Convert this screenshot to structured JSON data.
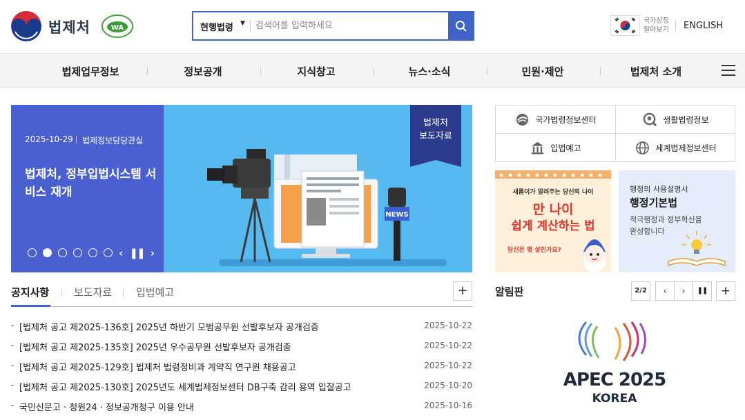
{
  "header": {
    "site_name": "법제처",
    "search": {
      "scope": "현행법령",
      "placeholder": "검색어를 입력하세요"
    },
    "national_symbols": "국가상징\n알아보기",
    "language": "ENGLISH"
  },
  "nav": {
    "items": [
      {
        "label": "법제업무정보"
      },
      {
        "label": "정보공개"
      },
      {
        "label": "지식창고"
      },
      {
        "label": "뉴스·소식"
      },
      {
        "label": "민원·제안"
      },
      {
        "label": "법제처 소개"
      }
    ]
  },
  "banner": {
    "date": "2025-10-29",
    "department": "법제정보담당관실",
    "title": "법제처, 정부입법시스템 서비스 재개",
    "badge": "법제처\n보도자료",
    "slide_count": 6,
    "active_slide": 2,
    "news_label": "NEWS"
  },
  "quick_links": [
    {
      "label": "국가법령정보센터",
      "icon": "globe-swirl-icon"
    },
    {
      "label": "생활법령정보",
      "icon": "search-person-icon"
    },
    {
      "label": "입법예고",
      "icon": "building-icon"
    },
    {
      "label": "세계법제정보센터",
      "icon": "globe-icon"
    }
  ],
  "promo_age": {
    "top": "새롬이가 알려주는 당신의 나이",
    "line1": "만 나이",
    "line2": "쉽게 계산하는 법",
    "question": "당신은 몇 살인가요?"
  },
  "promo_admin": {
    "subtitle": "행정의 사용설명서",
    "title": "행정기본법",
    "desc": "적극행정과 정부혁신을\n완성합니다"
  },
  "notice_tabs": [
    {
      "label": "공지사항",
      "active": true
    },
    {
      "label": "보도자료"
    },
    {
      "label": "입법예고"
    }
  ],
  "notices": [
    {
      "title": "[법제처 공고 제2025-136호] 2025년 하반기 모범공무원 선발후보자 공개검증",
      "date": "2025-10-22"
    },
    {
      "title": "[법제처 공고 제2025-135호] 2025년 우수공무원 선발후보자 공개검증",
      "date": "2025-10-22"
    },
    {
      "title": "[법제처 공고 제2025-129호] 법제처 법령정비과 계약직 연구원 채용공고",
      "date": "2025-10-22"
    },
    {
      "title": "[법제처 공고 제2025-130호] 2025년도 세계법제정보센터 DB구축 감리 용역 입찰공고",
      "date": "2025-10-20"
    },
    {
      "title": "국민신문고 · 청원24 · 정보공개청구 이용 안내",
      "date": "2025-10-16"
    }
  ],
  "board": {
    "title": "알림판",
    "page": "2/2",
    "apec_line1": "APEC 2025",
    "apec_line2": "KOREA"
  },
  "colors": {
    "primary": "#4a5fd0",
    "search_border": "#3f63c7",
    "banner_bg": "#56baf0",
    "badge": "#2d3b8c"
  }
}
